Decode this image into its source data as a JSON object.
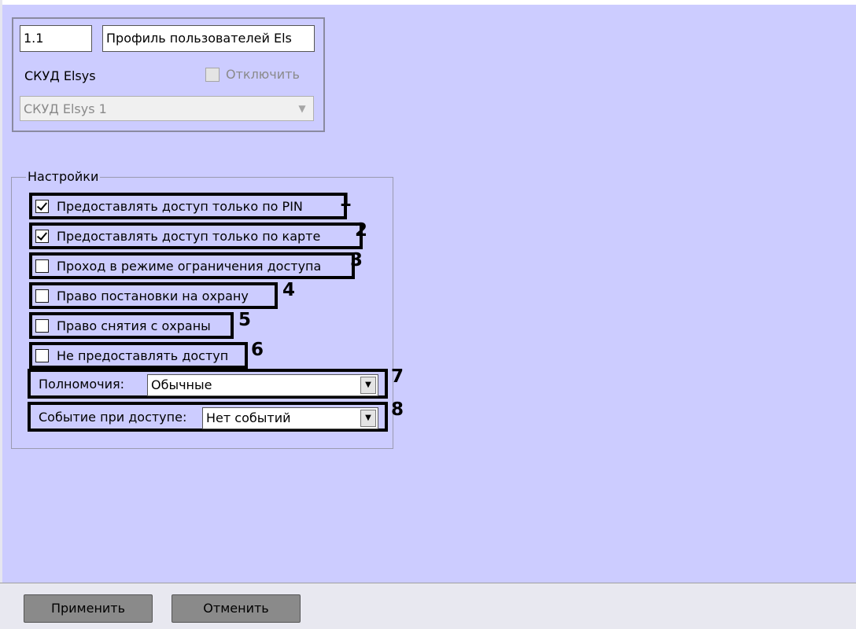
{
  "object": {
    "id": "1.1",
    "name": "Профиль пользователей Els",
    "type_label": "СКУД Elsys",
    "disable_label": "Отключить",
    "parent": "СКУД Elsys 1"
  },
  "settings": {
    "group_title": "Настройки",
    "checkboxes": [
      {
        "label": "Предоставлять доступ только по PIN",
        "checked": true,
        "marker": "1"
      },
      {
        "label": "Предоставлять доступ только по карте",
        "checked": true,
        "marker": "2"
      },
      {
        "label": "Проход в режиме ограничения доступа",
        "checked": false,
        "marker": "3"
      },
      {
        "label": "Право постановки на охрану",
        "checked": false,
        "marker": "4"
      },
      {
        "label": "Право снятия с охраны",
        "checked": false,
        "marker": "5"
      },
      {
        "label": "Не предоставлять доступ",
        "checked": false,
        "marker": "6"
      }
    ],
    "authority": {
      "label": "Полномочия:",
      "value": "Обычные",
      "marker": "7"
    },
    "access_event": {
      "label": "Событие при доступе:",
      "value": "Нет событий",
      "marker": "8"
    }
  },
  "buttons": {
    "apply": "Применить",
    "cancel": "Отменить"
  }
}
